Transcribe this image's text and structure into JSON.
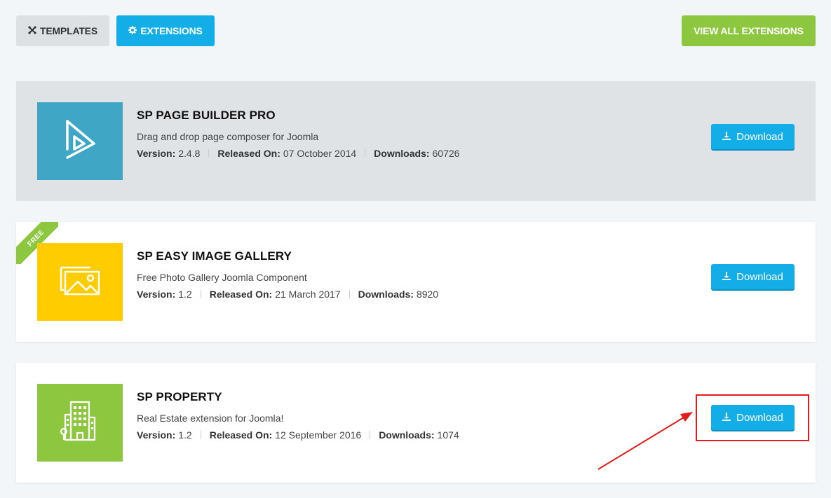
{
  "nav": {
    "templates_label": "TEMPLATES",
    "templates_icon": "joomla-icon",
    "extensions_label": "EXTENSIONS",
    "extensions_icon": "gear-icon",
    "view_all_label": "VIEW ALL EXTENSIONS"
  },
  "labels": {
    "version": "Version:",
    "released": "Released On:",
    "downloads": "Downloads:",
    "download_button": "Download",
    "free_badge": "FREE"
  },
  "extensions": [
    {
      "title": "SP PAGE BUILDER PRO",
      "description": "Drag and drop page composer for Joomla",
      "version": "2.4.8",
      "released": "07 October 2014",
      "downloads": "60726",
      "thumb_color": "#3fa6c6",
      "icon": "play-icon",
      "active": true
    },
    {
      "title": "SP EASY IMAGE GALLERY",
      "description": "Free Photo Gallery Joomla Component",
      "version": "1.2",
      "released": "21 March 2017",
      "downloads": "8920",
      "thumb_color": "#ffcc00",
      "icon": "gallery-icon",
      "free": true
    },
    {
      "title": "SP PROPERTY",
      "description": "Real Estate extension for Joomla!",
      "version": "1.2",
      "released": "12 September 2016",
      "downloads": "1074",
      "thumb_color": "#8dc73f",
      "icon": "building-icon"
    }
  ],
  "colors": {
    "accent_blue": "#13aee8",
    "accent_green": "#8dc73f",
    "annotation_red": "#e21c1c"
  }
}
